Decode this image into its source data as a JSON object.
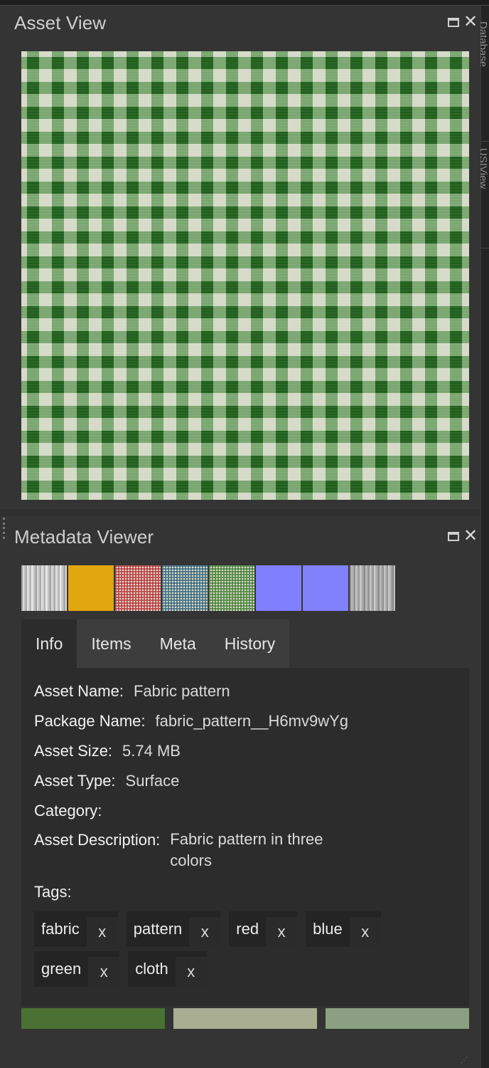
{
  "asset_view": {
    "title": "Asset View",
    "preview_colors": {
      "base": "#d6dbc8",
      "green": "#2f7a28",
      "dark_green": "#1f5f1c",
      "light": "#e9ecdf"
    }
  },
  "side_tabs": [
    "Database",
    "USIView"
  ],
  "metadata_viewer": {
    "title": "Metadata Viewer",
    "thumbnails": [
      {
        "name": "grayscale-streaks",
        "colors": [
          "#f0f0f0",
          "#8f8f8f"
        ]
      },
      {
        "name": "solid-gold",
        "colors": [
          "#e2a60e",
          "#e2a60e"
        ]
      },
      {
        "name": "red-gingham",
        "colors": [
          "#b03030",
          "#e8d8d0"
        ]
      },
      {
        "name": "blue-gingham",
        "colors": [
          "#2f5f78",
          "#d9dccb"
        ]
      },
      {
        "name": "green-gingham",
        "colors": [
          "#3f7a30",
          "#d6dbc8"
        ]
      },
      {
        "name": "normal-map",
        "colors": [
          "#8080ff",
          "#8080ff"
        ]
      },
      {
        "name": "normal-map-2",
        "colors": [
          "#8181fb",
          "#8181fb"
        ]
      },
      {
        "name": "gray-streaks",
        "colors": [
          "#cfcfcf",
          "#7a7a7a"
        ]
      }
    ],
    "tabs": [
      "Info",
      "Items",
      "Meta",
      "History"
    ],
    "active_tab": "Info",
    "info": {
      "asset_name_label": "Asset Name:",
      "asset_name": "Fabric pattern",
      "package_name_label": "Package Name:",
      "package_name": "fabric_pattern__H6mv9wYg",
      "asset_size_label": "Asset Size:",
      "asset_size": "5.74 MB",
      "asset_type_label": "Asset Type:",
      "asset_type": "Surface",
      "category_label": "Category:",
      "category": "",
      "description_label": "Asset Description:",
      "description": "Fabric pattern in three colors",
      "tags_label": "Tags:",
      "tags": [
        "fabric",
        "pattern",
        "red",
        "blue",
        "green",
        "cloth"
      ],
      "tag_remove": "x"
    },
    "swatches": [
      "#4b7034",
      "#a9ae93",
      "#8ba082"
    ]
  }
}
